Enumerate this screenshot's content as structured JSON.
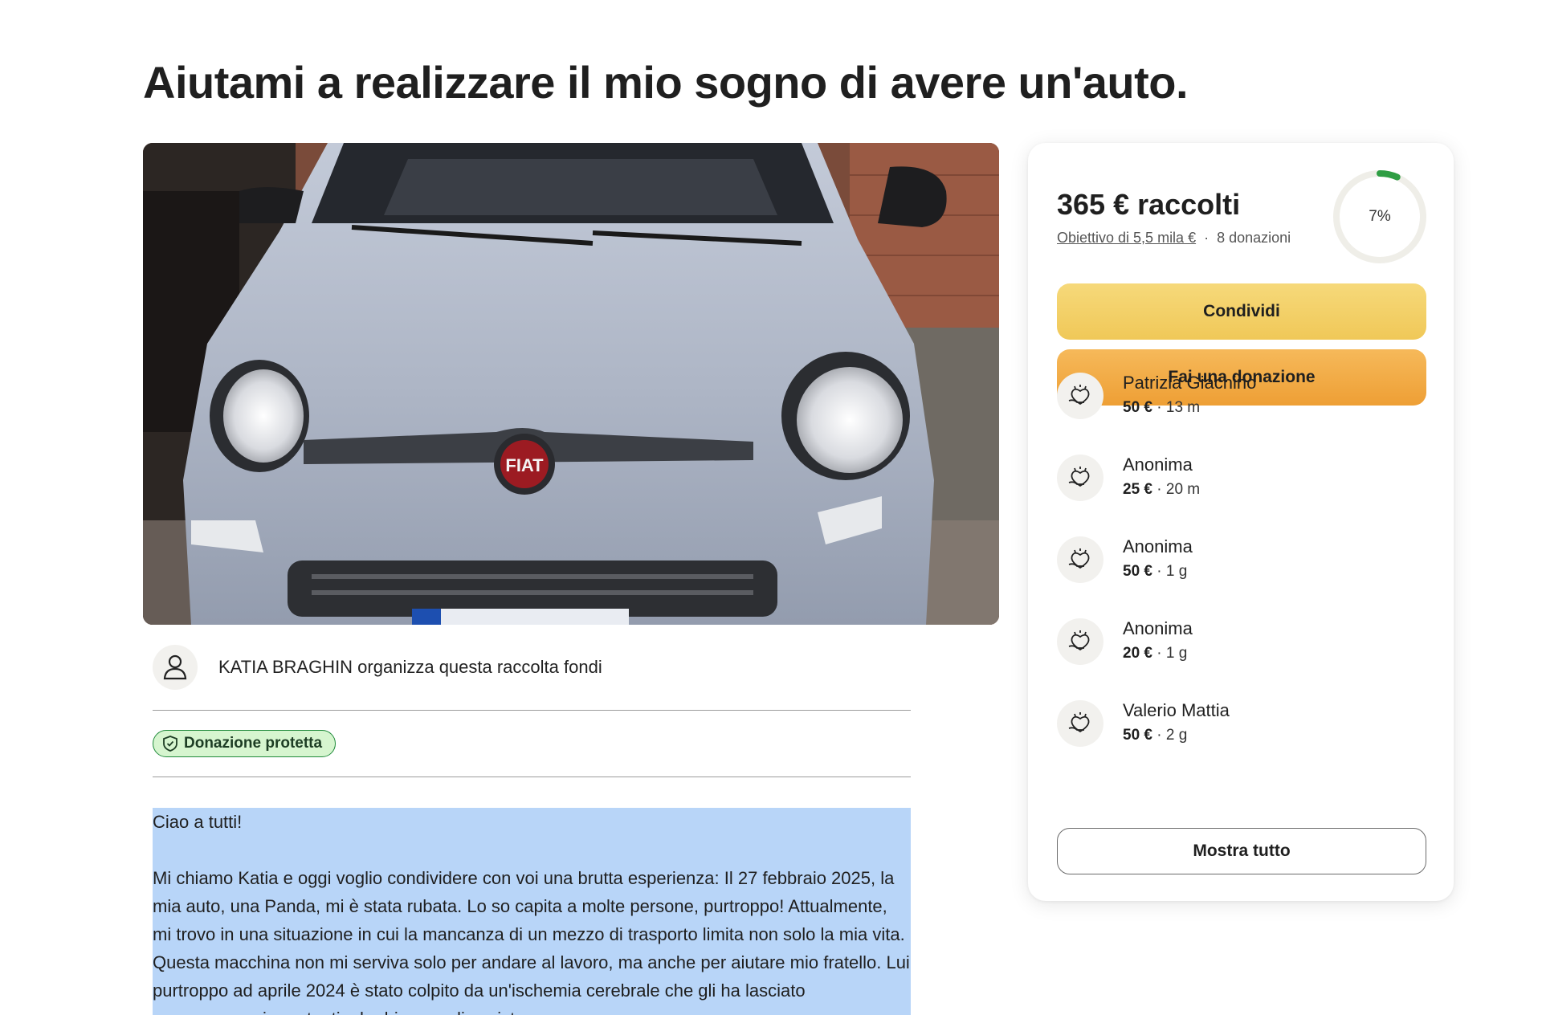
{
  "page": {
    "title": "Aiutami a realizzare il mio sogno di avere un'auto."
  },
  "hero": {
    "image_alt": "FIAT",
    "car_logo_text": "FIAT"
  },
  "organizer": {
    "text": "KATIA BRAGHIN organizza questa raccolta fondi"
  },
  "badge": {
    "label": "Donazione protetta"
  },
  "story": {
    "paragraphs": [
      "Ciao a tutti!",
      "Mi chiamo Katia e oggi voglio condividere con voi una brutta esperienza: Il 27 febbraio 2025, la mia auto, una Panda, mi è stata rubata. Lo so capita a molte persone, purtroppo! Attualmente, mi trovo in una situazione in cui la mancanza di un mezzo di trasporto limita non solo la mia vita. Questa macchina non mi serviva solo per andare al lavoro, ma anche per aiutare mio fratello. Lui purtroppo ad aprile 2024 è stato colpito da un'ischemia cerebrale che gli ha lasciato conseguenze importanti e ha bisogno di assistenza"
    ]
  },
  "card": {
    "raised": "365 € raccolti",
    "goal": "Obiettivo di 5,5 mila €",
    "separator": "·",
    "donations_count": "8 donazioni",
    "progress_label": "7%",
    "progress_fraction": 0.066,
    "colors": {
      "progress": "#2f9e44",
      "track": "#efeee8"
    },
    "share_label": "Condividi",
    "donate_label": "Fai una donazione",
    "show_all_label": "Mostra tutto",
    "donors": [
      {
        "name": "Patrizia Giachino",
        "amount": "50 €",
        "time": "· 13 m"
      },
      {
        "name": "Anonima",
        "amount": "25 €",
        "time": "· 20 m"
      },
      {
        "name": "Anonima",
        "amount": "50 €",
        "time": "· 1 g"
      },
      {
        "name": "Anonima",
        "amount": "20 €",
        "time": "· 1 g"
      },
      {
        "name": "Valerio Mattia",
        "amount": "50 €",
        "time": "· 2 g"
      }
    ]
  }
}
